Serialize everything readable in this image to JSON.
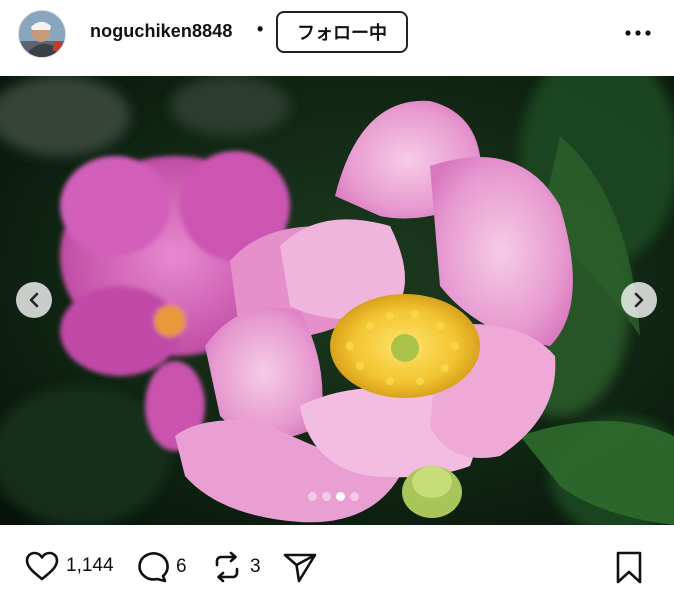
{
  "header": {
    "username": "noguchiken8848",
    "separator": "•",
    "follow_label": "フォロー中",
    "more_icon": "more-horizontal-icon"
  },
  "media": {
    "carousel": {
      "total": 4,
      "active_index": 2
    },
    "prev_icon": "chevron-left-icon",
    "next_icon": "chevron-right-icon"
  },
  "actions": {
    "likes": "1,144",
    "comments": "6",
    "reposts": "3"
  }
}
